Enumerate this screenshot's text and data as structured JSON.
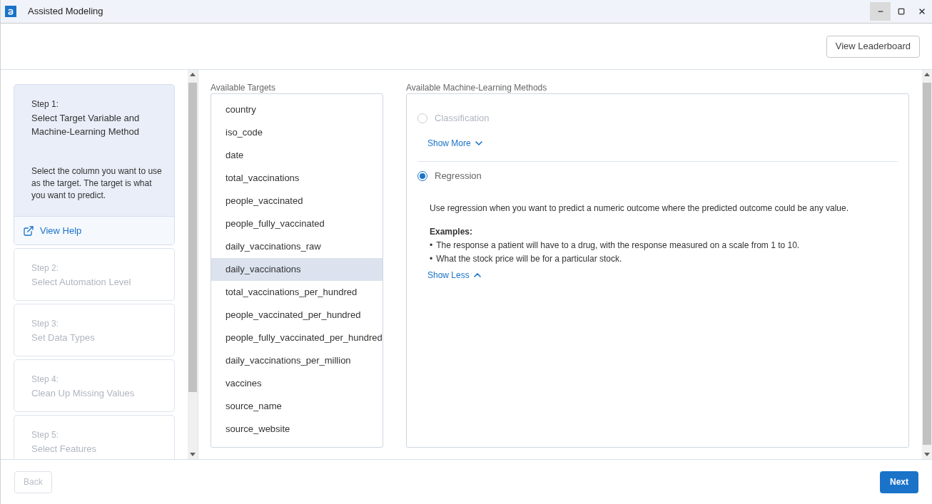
{
  "window": {
    "title": "Assisted Modeling"
  },
  "toolbar": {
    "leaderboard_button": "View Leaderboard"
  },
  "steps": [
    {
      "number": "Step 1:",
      "title": "Select Target Variable and Machine-Learning Method",
      "description": "Select the column you want to use as the target. The target is what you want to predict.",
      "help_link": "View Help",
      "selected": true
    },
    {
      "number": "Step 2:",
      "title": "Select Automation Level",
      "selected": false
    },
    {
      "number": "Step 3:",
      "title": "Set Data Types",
      "selected": false
    },
    {
      "number": "Step 4:",
      "title": "Clean Up Missing Values",
      "selected": false
    },
    {
      "number": "Step 5:",
      "title": "Select Features",
      "selected": false
    }
  ],
  "targets": {
    "label": "Available Targets",
    "items": [
      {
        "name": "country",
        "selected": false
      },
      {
        "name": "iso_code",
        "selected": false
      },
      {
        "name": "date",
        "selected": false
      },
      {
        "name": "total_vaccinations",
        "selected": false
      },
      {
        "name": "people_vaccinated",
        "selected": false
      },
      {
        "name": "people_fully_vaccinated",
        "selected": false
      },
      {
        "name": "daily_vaccinations_raw",
        "selected": false
      },
      {
        "name": "daily_vaccinations",
        "selected": true
      },
      {
        "name": "total_vaccinations_per_hundred",
        "selected": false
      },
      {
        "name": "people_vaccinated_per_hundred",
        "selected": false
      },
      {
        "name": "people_fully_vaccinated_per_hundred",
        "selected": false
      },
      {
        "name": "daily_vaccinations_per_million",
        "selected": false
      },
      {
        "name": "vaccines",
        "selected": false
      },
      {
        "name": "source_name",
        "selected": false
      },
      {
        "name": "source_website",
        "selected": false
      }
    ]
  },
  "methods": {
    "label": "Available Machine-Learning Methods",
    "items": [
      {
        "name": "Classification",
        "selected": false,
        "disabled": true,
        "expanded": false,
        "toggle": "Show More"
      },
      {
        "name": "Regression",
        "selected": true,
        "disabled": false,
        "expanded": true,
        "toggle": "Show Less",
        "description": "Use regression when you want to predict a numeric outcome where the predicted outcome could be any value.",
        "examples_heading": "Examples:",
        "examples": [
          {
            "bullet": "•",
            "text": "The response a patient will have to a drug, with the response measured on a scale from 1 to 10."
          },
          {
            "bullet": "•",
            "text": "What the stock price will be for a particular stock."
          }
        ]
      }
    ]
  },
  "footer": {
    "back": {
      "label": "Back",
      "disabled": true
    },
    "next": {
      "label": "Next",
      "disabled": false
    }
  }
}
